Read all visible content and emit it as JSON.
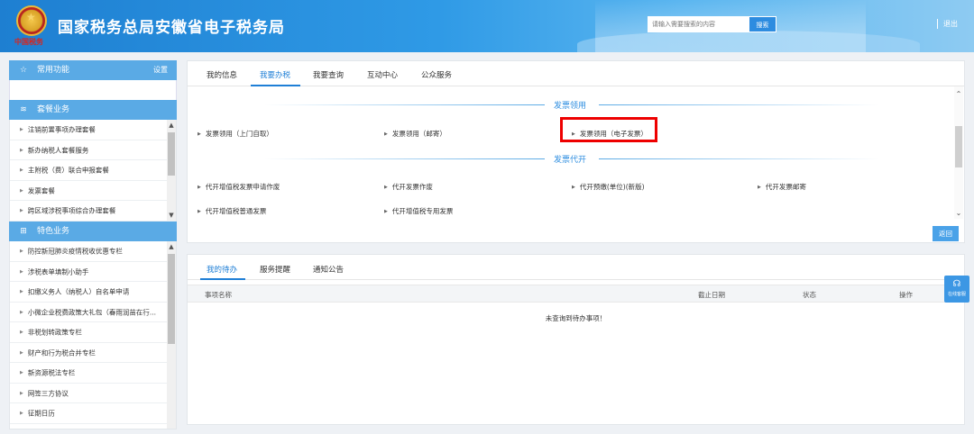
{
  "header": {
    "emblem_caption": "中国税务",
    "title": "国家税务总局安徽省电子税务局",
    "search": {
      "placeholder": "请输入需要搜索的内容",
      "button_label": "搜索"
    },
    "logout_label": "退出"
  },
  "sidebar": {
    "favorites": {
      "title": "常用功能",
      "action_label": "设置"
    },
    "package_services": {
      "title": "套餐业务",
      "items": [
        {
          "label": "注销前置事项办理套餐"
        },
        {
          "label": "新办纳税人套餐服务"
        },
        {
          "label": "主附税（费）联合申报套餐"
        },
        {
          "label": "发票套餐"
        },
        {
          "label": "跨区域涉税事项综合办理套餐"
        }
      ]
    },
    "special_services": {
      "title": "特色业务",
      "items": [
        {
          "label": "防控新冠肺炎疫情税收优惠专栏"
        },
        {
          "label": "涉税表单填制小助手"
        },
        {
          "label": "扣缴义务人（纳税人）自名单申请"
        },
        {
          "label": "小微企业税费政策大礼包（春雨润苗在行..."
        },
        {
          "label": "非税划转政策专栏"
        },
        {
          "label": "财产和行为税合并专栏"
        },
        {
          "label": "新资源税法专栏"
        },
        {
          "label": "网签三方协议"
        },
        {
          "label": "征期日历"
        }
      ]
    }
  },
  "main_tabs": {
    "tabs": [
      {
        "label": "我的信息"
      },
      {
        "label": "我要办税"
      },
      {
        "label": "我要查询"
      },
      {
        "label": "互动中心"
      },
      {
        "label": "公众服务"
      }
    ],
    "active_index": 1
  },
  "invoice_use": {
    "title": "发票领用",
    "items": [
      {
        "label": "发票领用（上门自取）"
      },
      {
        "label": "发票领用（邮寄）"
      },
      {
        "label": "发票领用（电子发票）"
      }
    ],
    "highlighted_index": 2
  },
  "invoice_agency": {
    "title": "发票代开",
    "items": [
      {
        "label": "代开增值税发票申请作废"
      },
      {
        "label": "代开发票作废"
      },
      {
        "label": "代开预缴(单位)(新版)"
      },
      {
        "label": "代开发票邮寄"
      },
      {
        "label": "代开增值税普通发票"
      },
      {
        "label": "代开增值税专用发票"
      }
    ]
  },
  "back_button_label": "返回",
  "todo_panel": {
    "tabs": [
      {
        "label": "我的待办"
      },
      {
        "label": "服务提醒"
      },
      {
        "label": "通知公告"
      }
    ],
    "active_index": 0,
    "columns": {
      "name": "事项名称",
      "deadline": "截止日期",
      "status": "状态",
      "action": "操作"
    },
    "empty_message": "未查询到待办事项！"
  },
  "float_service": {
    "label": "在线客服"
  },
  "colors": {
    "accent": "#1f7fd6",
    "sidebar_header": "#5aaae5",
    "highlight": "#ee0000"
  }
}
